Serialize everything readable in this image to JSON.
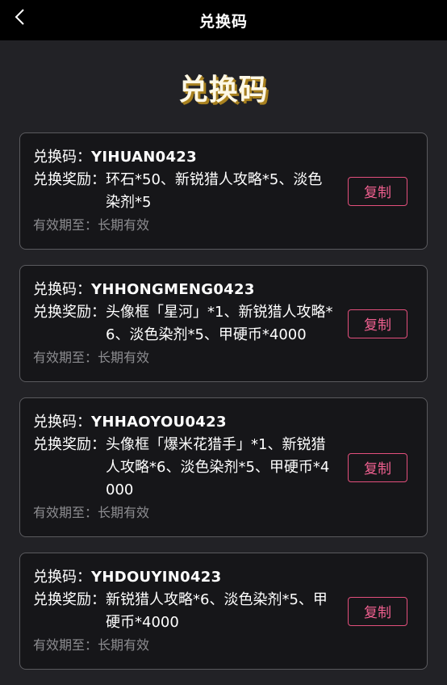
{
  "header": {
    "title": "兑换码",
    "back_icon": "chevron-left-icon"
  },
  "page": {
    "title": "兑换码"
  },
  "labels": {
    "code": "兑换码：",
    "reward": "兑换奖励：",
    "valid": "有效期至："
  },
  "cards": [
    {
      "code": "YIHUAN0423",
      "reward": "环石*50、新锐猎人攻略*5、淡色染剂*5",
      "valid": "长期有效",
      "copy_label": "复制"
    },
    {
      "code": "YHHONGMENG0423",
      "reward": "头像框「星河」*1、新锐猎人攻略*6、淡色染剂*5、甲硬币*4000",
      "valid": "长期有效",
      "copy_label": "复制"
    },
    {
      "code": "YHHAOYOU0423",
      "reward": "头像框「爆米花猎手」*1、新锐猎人攻略*6、淡色染剂*5、甲硬币*4000",
      "valid": "长期有效",
      "copy_label": "复制"
    },
    {
      "code": "YHDOUYIN0423",
      "reward": "新锐猎人攻略*6、淡色染剂*5、甲硬币*4000",
      "valid": "长期有效",
      "copy_label": "复制"
    }
  ],
  "colors": {
    "accent": "#e34f7c",
    "title_shadow": "#a8811f",
    "background": "#222226",
    "card": "#161619"
  }
}
